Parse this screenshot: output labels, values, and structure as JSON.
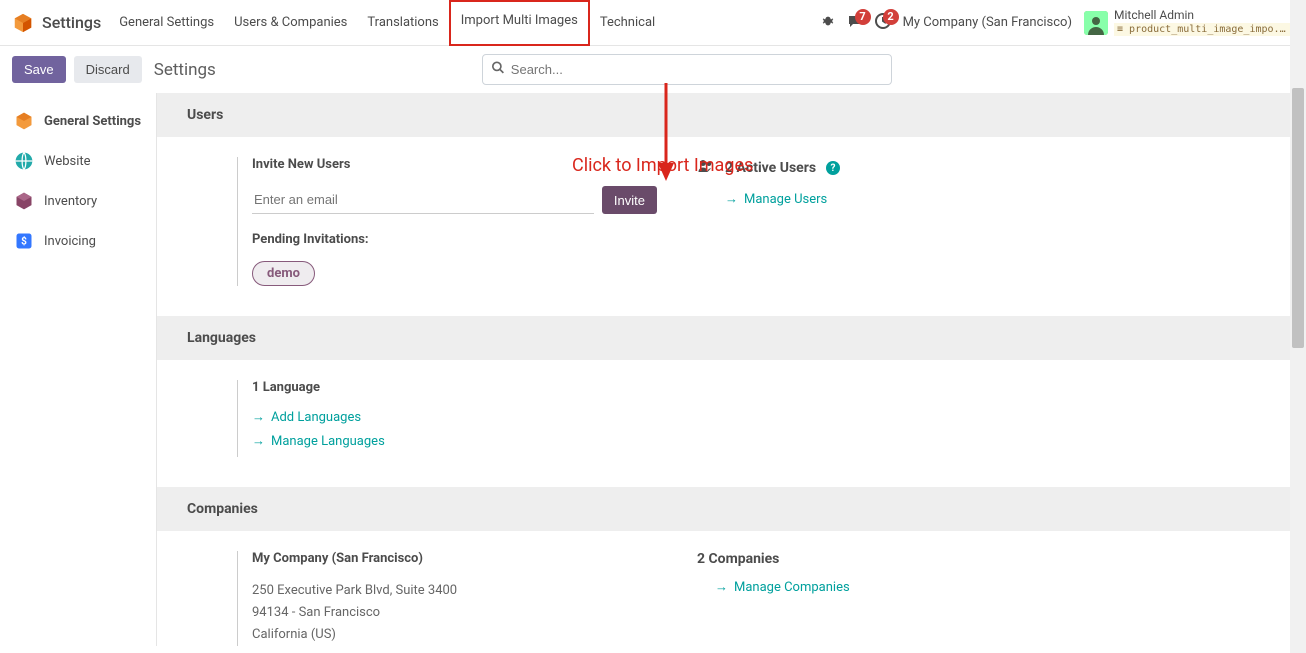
{
  "brand": "Settings",
  "nav": {
    "general": "General Settings",
    "users": "Users & Companies",
    "translations": "Translations",
    "import": "Import Multi Images",
    "technical": "Technical"
  },
  "systray": {
    "messages_badge": "7",
    "activities_badge": "2",
    "company": "My Company (San Francisco)",
    "user_name": "Mitchell Admin",
    "db_name": "product_multi_image_impo..."
  },
  "control": {
    "save": "Save",
    "discard": "Discard",
    "title": "Settings",
    "search_placeholder": "Search..."
  },
  "sidebar": {
    "items": [
      {
        "label": "General Settings"
      },
      {
        "label": "Website"
      },
      {
        "label": "Inventory"
      },
      {
        "label": "Invoicing"
      }
    ]
  },
  "annotation": "Click to Import Images",
  "sections": {
    "users": {
      "header": "Users",
      "invite_title": "Invite New Users",
      "email_placeholder": "Enter an email",
      "invite_btn": "Invite",
      "pending_title": "Pending Invitations:",
      "pending_pill": "demo",
      "active_count": "2",
      "active_label": "Active Users",
      "manage": "Manage Users"
    },
    "languages": {
      "header": "Languages",
      "count_line": "1 Language",
      "add": "Add Languages",
      "manage": "Manage Languages"
    },
    "companies": {
      "header": "Companies",
      "name": "My Company (San Francisco)",
      "addr1": "250 Executive Park Blvd, Suite 3400",
      "addr2": "94134 - San Francisco",
      "addr3": "California (US)",
      "count_line": "2 Companies",
      "manage": "Manage Companies"
    }
  }
}
